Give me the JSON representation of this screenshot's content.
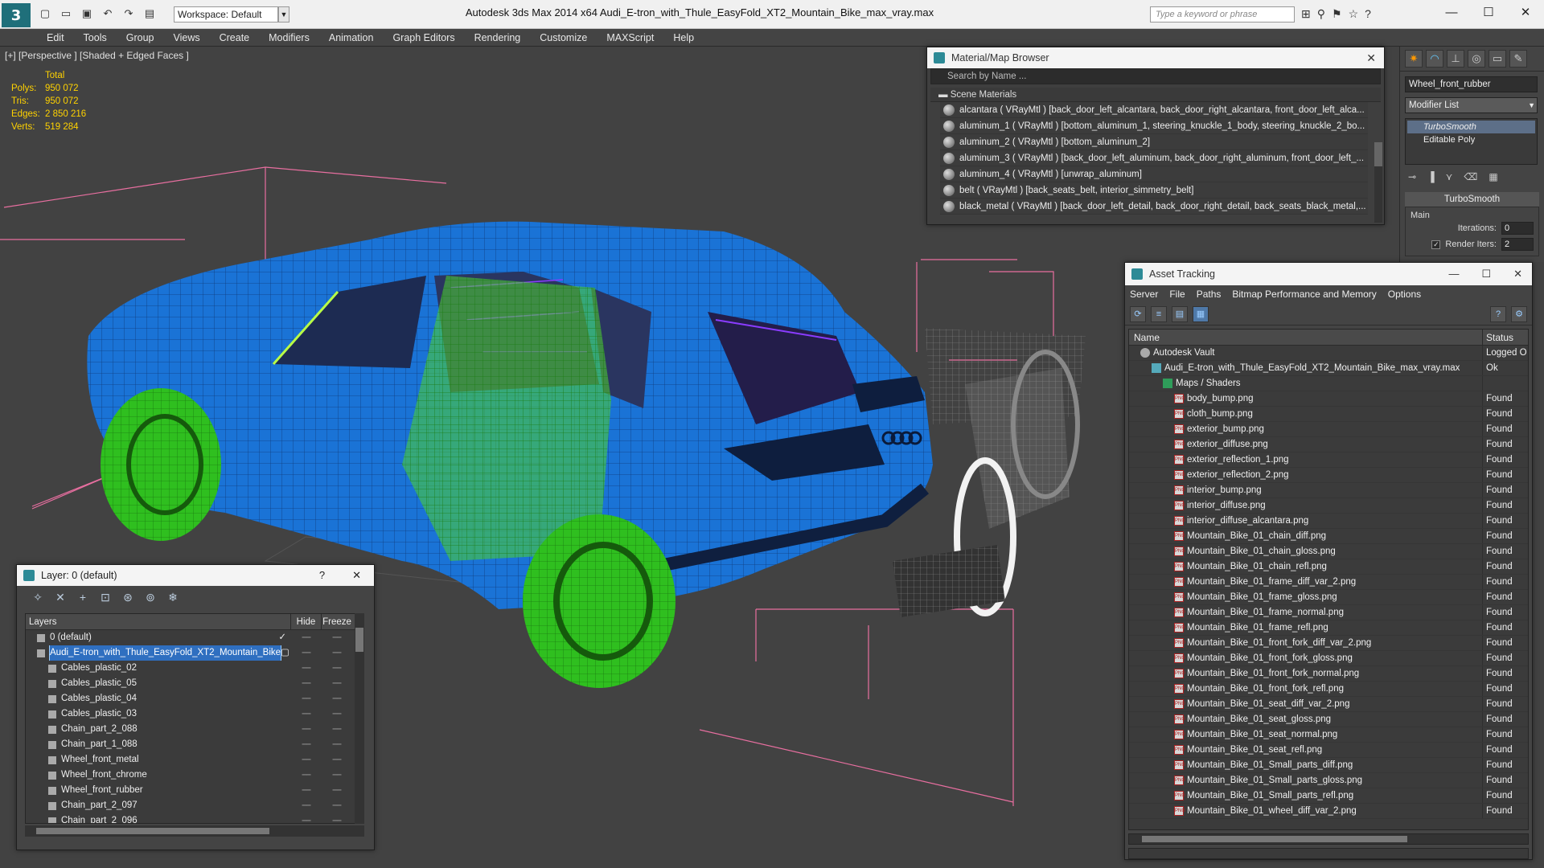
{
  "app": {
    "title": "Autodesk 3ds Max  2014 x64     Audi_E-tron_with_Thule_EasyFold_XT2_Mountain_Bike_max_vray.max",
    "logo": "3",
    "workspace": "Workspace: Default",
    "search_placeholder": "Type a keyword or phrase"
  },
  "menu": [
    "Edit",
    "Tools",
    "Group",
    "Views",
    "Create",
    "Modifiers",
    "Animation",
    "Graph Editors",
    "Rendering",
    "Customize",
    "MAXScript",
    "Help"
  ],
  "viewport": {
    "label": "[+] [Perspective ] [Shaded + Edged Faces ]",
    "stats": {
      "header": "Total",
      "rows": [
        {
          "k": "Polys:",
          "v": "950 072"
        },
        {
          "k": "Tris:",
          "v": "950 072"
        },
        {
          "k": "Edges:",
          "v": "2 850 216"
        },
        {
          "k": "Verts:",
          "v": "519 284"
        }
      ]
    }
  },
  "material_browser": {
    "title": "Material/Map Browser",
    "search_placeholder": "Search by Name ...",
    "section": "Scene Materials",
    "materials": [
      "alcantara  ( VRayMtl ) [back_door_left_alcantara, back_door_right_alcantara, front_door_left_alca...",
      "aluminum_1  ( VRayMtl ) [bottom_aluminum_1, steering_knuckle_1_body, steering_knuckle_2_bo...",
      "aluminum_2  ( VRayMtl ) [bottom_aluminum_2]",
      "aluminum_3  ( VRayMtl ) [back_door_left_aluminum, back_door_right_aluminum, front_door_left_...",
      "aluminum_4  ( VRayMtl ) [unwrap_aluminum]",
      "belt  ( VRayMtl ) [back_seats_belt, interior_simmetry_belt]",
      "black_metal  ( VRayMtl ) [back_door_left_detail, back_door_right_detail, back_seats_black_metal,..."
    ]
  },
  "command_panel": {
    "object_name": "Wheel_front_rubber",
    "modifier_list": "Modifier List",
    "stack": [
      "TurboSmooth",
      "Editable Poly"
    ],
    "rollout_title": "TurboSmooth",
    "group": "Main",
    "iterations_label": "Iterations:",
    "iterations": "0",
    "render_iters_label": "Render Iters:",
    "render_iters": "2",
    "render_iters_checked": "✓"
  },
  "asset_tracking": {
    "title": "Asset Tracking",
    "menu": [
      "Server",
      "File",
      "Paths",
      "Bitmap Performance and Memory",
      "Options"
    ],
    "col_name": "Name",
    "col_status": "Status",
    "rows": [
      {
        "name": "Autodesk Vault",
        "status": "Logged O",
        "indent": 1,
        "icon": "vault"
      },
      {
        "name": "Audi_E-tron_with_Thule_EasyFold_XT2_Mountain_Bike_max_vray.max",
        "status": "Ok",
        "indent": 2,
        "icon": "max"
      },
      {
        "name": "Maps / Shaders",
        "status": "",
        "indent": 3,
        "icon": "maps"
      },
      {
        "name": "body_bump.png",
        "status": "Found",
        "indent": 4,
        "icon": "png"
      },
      {
        "name": "cloth_bump.png",
        "status": "Found",
        "indent": 4,
        "icon": "png"
      },
      {
        "name": "exterior_bump.png",
        "status": "Found",
        "indent": 4,
        "icon": "png"
      },
      {
        "name": "exterior_diffuse.png",
        "status": "Found",
        "indent": 4,
        "icon": "png"
      },
      {
        "name": "exterior_reflection_1.png",
        "status": "Found",
        "indent": 4,
        "icon": "png"
      },
      {
        "name": "exterior_reflection_2.png",
        "status": "Found",
        "indent": 4,
        "icon": "png"
      },
      {
        "name": "interior_bump.png",
        "status": "Found",
        "indent": 4,
        "icon": "png"
      },
      {
        "name": "interior_diffuse.png",
        "status": "Found",
        "indent": 4,
        "icon": "png"
      },
      {
        "name": "interior_diffuse_alcantara.png",
        "status": "Found",
        "indent": 4,
        "icon": "png"
      },
      {
        "name": "Mountain_Bike_01_chain_diff.png",
        "status": "Found",
        "indent": 4,
        "icon": "png"
      },
      {
        "name": "Mountain_Bike_01_chain_gloss.png",
        "status": "Found",
        "indent": 4,
        "icon": "png"
      },
      {
        "name": "Mountain_Bike_01_chain_refl.png",
        "status": "Found",
        "indent": 4,
        "icon": "png"
      },
      {
        "name": "Mountain_Bike_01_frame_diff_var_2.png",
        "status": "Found",
        "indent": 4,
        "icon": "png"
      },
      {
        "name": "Mountain_Bike_01_frame_gloss.png",
        "status": "Found",
        "indent": 4,
        "icon": "png"
      },
      {
        "name": "Mountain_Bike_01_frame_normal.png",
        "status": "Found",
        "indent": 4,
        "icon": "png"
      },
      {
        "name": "Mountain_Bike_01_frame_refl.png",
        "status": "Found",
        "indent": 4,
        "icon": "png"
      },
      {
        "name": "Mountain_Bike_01_front_fork_diff_var_2.png",
        "status": "Found",
        "indent": 4,
        "icon": "png"
      },
      {
        "name": "Mountain_Bike_01_front_fork_gloss.png",
        "status": "Found",
        "indent": 4,
        "icon": "png"
      },
      {
        "name": "Mountain_Bike_01_front_fork_normal.png",
        "status": "Found",
        "indent": 4,
        "icon": "png"
      },
      {
        "name": "Mountain_Bike_01_front_fork_refl.png",
        "status": "Found",
        "indent": 4,
        "icon": "png"
      },
      {
        "name": "Mountain_Bike_01_seat_diff_var_2.png",
        "status": "Found",
        "indent": 4,
        "icon": "png"
      },
      {
        "name": "Mountain_Bike_01_seat_gloss.png",
        "status": "Found",
        "indent": 4,
        "icon": "png"
      },
      {
        "name": "Mountain_Bike_01_seat_normal.png",
        "status": "Found",
        "indent": 4,
        "icon": "png"
      },
      {
        "name": "Mountain_Bike_01_seat_refl.png",
        "status": "Found",
        "indent": 4,
        "icon": "png"
      },
      {
        "name": "Mountain_Bike_01_Small_parts_diff.png",
        "status": "Found",
        "indent": 4,
        "icon": "png"
      },
      {
        "name": "Mountain_Bike_01_Small_parts_gloss.png",
        "status": "Found",
        "indent": 4,
        "icon": "png"
      },
      {
        "name": "Mountain_Bike_01_Small_parts_refl.png",
        "status": "Found",
        "indent": 4,
        "icon": "png"
      },
      {
        "name": "Mountain_Bike_01_wheel_diff_var_2.png",
        "status": "Found",
        "indent": 4,
        "icon": "png"
      }
    ]
  },
  "layers": {
    "title": "Layer: 0 (default)",
    "help": "?",
    "close": "✕",
    "col_layers": "Layers",
    "col_hide": "Hide",
    "col_freeze": "Freeze",
    "rows": [
      {
        "name": "0 (default)",
        "indent": 1,
        "selected": false,
        "mark": "✓"
      },
      {
        "name": "Audi_E-tron_with_Thule_EasyFold_XT2_Mountain_Bike",
        "indent": 1,
        "selected": true,
        "mark": "▢"
      },
      {
        "name": "Cables_plastic_02",
        "indent": 2,
        "selected": false,
        "mark": ""
      },
      {
        "name": "Cables_plastic_05",
        "indent": 2,
        "selected": false,
        "mark": ""
      },
      {
        "name": "Cables_plastic_04",
        "indent": 2,
        "selected": false,
        "mark": ""
      },
      {
        "name": "Cables_plastic_03",
        "indent": 2,
        "selected": false,
        "mark": ""
      },
      {
        "name": "Chain_part_2_088",
        "indent": 2,
        "selected": false,
        "mark": ""
      },
      {
        "name": "Chain_part_1_088",
        "indent": 2,
        "selected": false,
        "mark": ""
      },
      {
        "name": "Wheel_front_metal",
        "indent": 2,
        "selected": false,
        "mark": ""
      },
      {
        "name": "Wheel_front_chrome",
        "indent": 2,
        "selected": false,
        "mark": ""
      },
      {
        "name": "Wheel_front_rubber",
        "indent": 2,
        "selected": false,
        "mark": ""
      },
      {
        "name": "Chain_part_2_097",
        "indent": 2,
        "selected": false,
        "mark": ""
      },
      {
        "name": "Chain_part_2_096",
        "indent": 2,
        "selected": false,
        "mark": ""
      }
    ]
  },
  "colors": {
    "car_body": "#1a73d6",
    "wheel_wire": "#3fd32a",
    "bbox": "#e86fa0",
    "stats": "#ffd200",
    "selection": "#2f6fc0"
  }
}
